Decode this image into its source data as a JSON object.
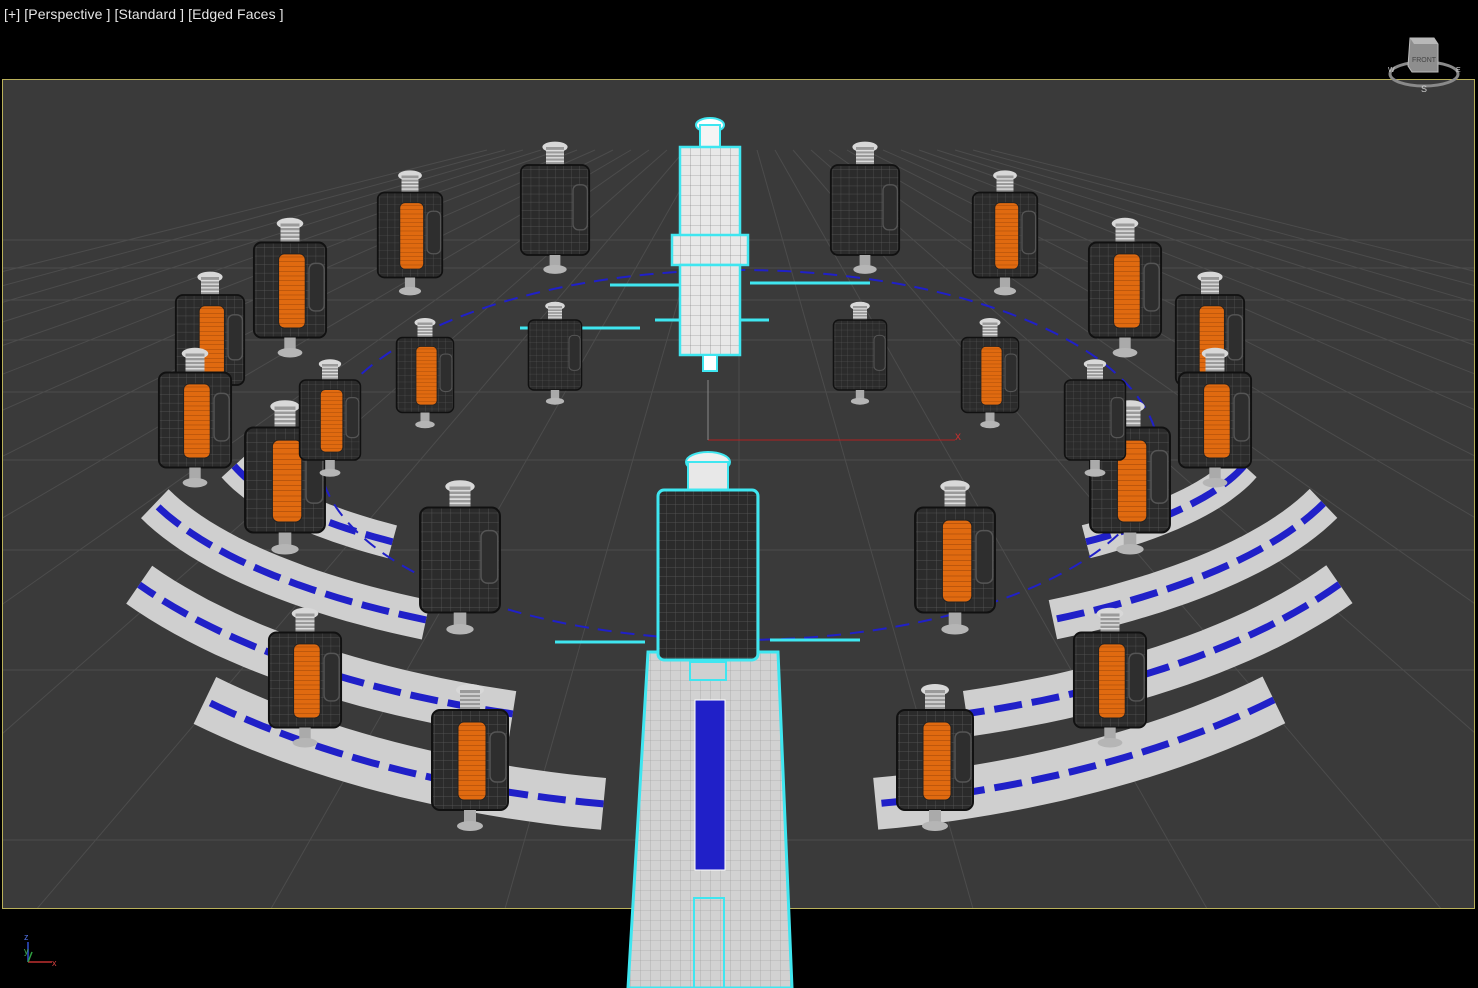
{
  "viewport": {
    "label_plus": "[+]",
    "label_view": "[Perspective ]",
    "label_shading": "[Standard ]",
    "label_style": "[Edged Faces ]"
  },
  "viewcube": {
    "face_label": "FRONT",
    "compass_south": "S",
    "left_label": "W",
    "right_label": "E"
  },
  "axis_tripod": {
    "z": "z",
    "y": "y",
    "x": "x"
  },
  "scene_axis": {
    "x_label": "x"
  },
  "colors": {
    "grid_background": "#3a3a3a",
    "grid_line": "#4a4a4a",
    "selection_cyan": "#3fe6f0",
    "wire_blue": "#2020c8",
    "coil_orange": "#e06a10",
    "housing_dark": "#2a2a2a",
    "track_light": "#c8c8c8",
    "safe_frame": "#b9b05a"
  },
  "icons": [
    "viewcube-icon",
    "axis-tripod-icon"
  ]
}
